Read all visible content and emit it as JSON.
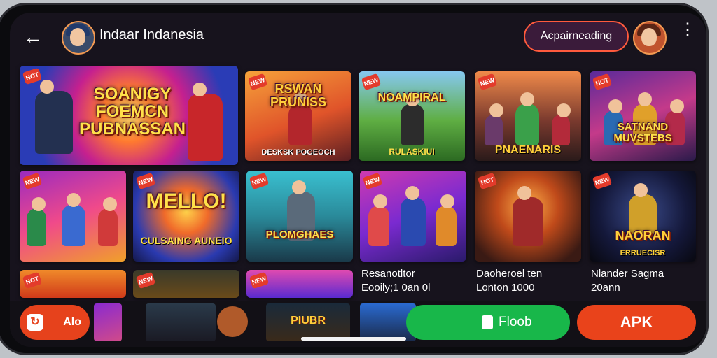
{
  "header": {
    "back_icon": "arrow-left-icon",
    "title": "Indaar Indanesia",
    "action_pill_label": "Acpairneading",
    "menu_icon": "more-vertical-icon"
  },
  "featured": {
    "title": "SOANIGY FOEMCN PUBNASSAN"
  },
  "tiles": [
    {
      "badge": "",
      "title": "RSWAN PRUNISS",
      "subtitle": "DESKSK POGEOCH"
    },
    {
      "badge": "",
      "title": "NOAMPIRAL",
      "subtitle": "RULASKIUI"
    },
    {
      "badge": "",
      "title": "",
      "subtitle": "PNAENARIS"
    },
    {
      "badge": "",
      "title": "SATNAND MUVSTEBS",
      "subtitle": ""
    },
    {
      "badge": "",
      "title": "",
      "subtitle": ""
    },
    {
      "badge": "",
      "title": "MELLO!",
      "subtitle": "CULSAING AUNEIO"
    },
    {
      "badge": "",
      "title": "PLOMGHAES",
      "subtitle": ""
    },
    {
      "badge": "",
      "title": "",
      "subtitle": ""
    },
    {
      "badge": "",
      "title": "",
      "subtitle": ""
    },
    {
      "badge": "",
      "title": "NAORAN",
      "subtitle": "ERRUECISR"
    }
  ],
  "captions": [
    {
      "line1": "Resanotltor",
      "line2": "Eooily;1 0an 0l"
    },
    {
      "line1": "Daoheroel ten",
      "line2": "Lonton 1000"
    },
    {
      "line1": "Nlander Sagma",
      "line2": "20ann"
    }
  ],
  "bottom_bar": {
    "aid_label": "Alo",
    "flood_label": "Floob",
    "apk_label": "APK",
    "strip_label": "PIUBR"
  },
  "colors": {
    "background": "#17131d",
    "accent_orange": "#e9431b",
    "accent_green": "#18b74a",
    "title_yellow": "#ffe14a"
  }
}
